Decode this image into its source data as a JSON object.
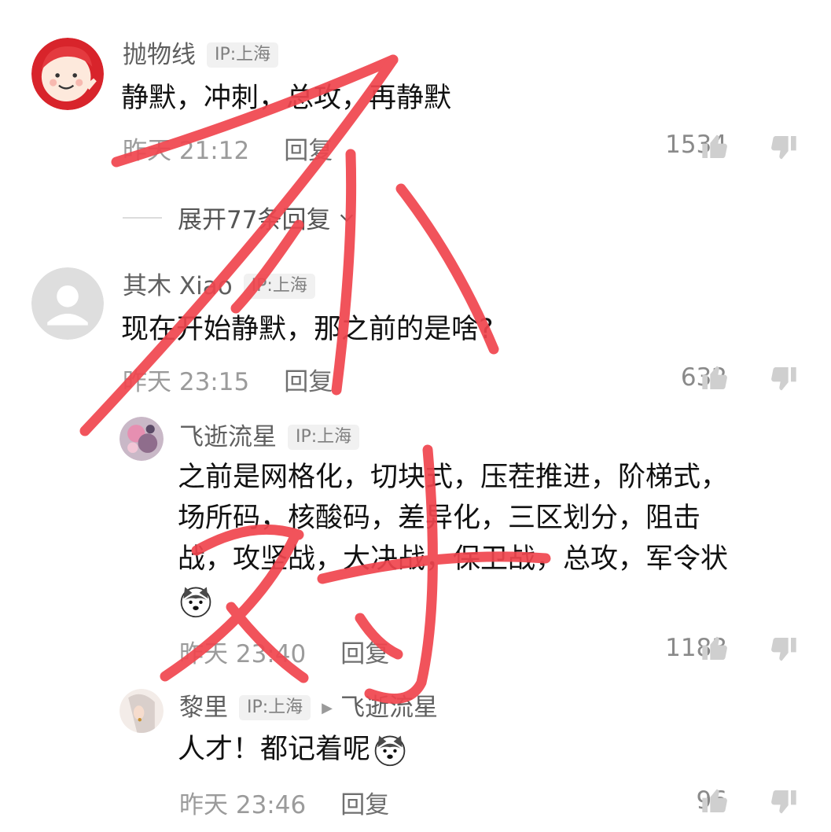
{
  "comments": [
    {
      "username": "抛物线",
      "ip": "IP:上海",
      "text": "静默，冲刺，总攻，再静默",
      "time": "昨天 21:12",
      "reply_label": "回复",
      "likes": "1534"
    },
    {
      "username": "其木 Xiao",
      "ip": "IP:上海",
      "text": "现在开始静默，那之前的是啥?",
      "time": "昨天 23:15",
      "reply_label": "回复",
      "likes": "632"
    },
    {
      "username": "飞逝流星",
      "ip": "IP:上海",
      "text_lines": [
        "之前是网格化，切块式，压茬推进，阶梯式，",
        "场所码，核酸码，差异化，三区划分，阻击",
        "战，攻坚战，大决战，保卫战，总攻，军令状"
      ],
      "time": "昨天 23:40",
      "reply_label": "回复",
      "likes": "1183"
    },
    {
      "username": "黎里",
      "ip": "IP:上海",
      "reply_to": "飞逝流星",
      "text": "人才！都记着呢",
      "time": "昨天 23:46",
      "reply_label": "回复",
      "likes": "96"
    }
  ],
  "expand": {
    "label": "展开77条回复"
  },
  "icons": {
    "like": "thumbs-up-icon",
    "dislike": "thumbs-down-icon",
    "emoji": "husky-dog-emoji",
    "chevron": "chevron-down-icon"
  },
  "colors": {
    "annotation": "#f0454e",
    "badge_bg": "#f1f1f1",
    "muted": "#9b9b9b"
  }
}
